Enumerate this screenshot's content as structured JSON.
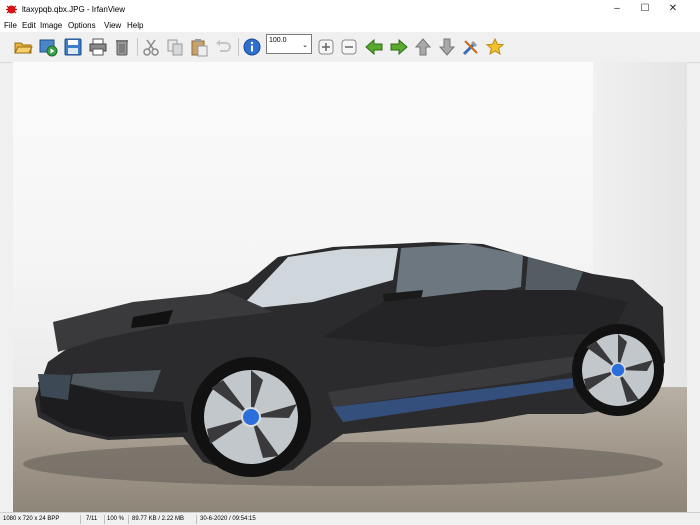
{
  "window": {
    "title": "ltaxypqb.qbx.JPG - IrfanView"
  },
  "menu": [
    "File",
    "Edit",
    "Image",
    "Options",
    "View",
    "Help"
  ],
  "toolbar": {
    "zoom_value": "100.0"
  },
  "icons": [
    "folder-open-icon",
    "slideshow-icon",
    "save-icon",
    "print-icon",
    "delete-icon",
    "cut-icon",
    "copy-icon",
    "paste-icon",
    "undo-icon",
    "info-icon",
    "zoom-in-icon",
    "zoom-out-icon",
    "previous-icon",
    "next-icon",
    "first-icon",
    "last-icon",
    "settings-icon",
    "favorite-icon"
  ],
  "status": {
    "dimensions": "1080 x 720 x 24 BPP",
    "index": "7/11",
    "zoom": "100 %",
    "filesize": "89.77 KB / 2.22 MB",
    "datetime": "30-6-2020 / 09:54:15"
  },
  "colors": {
    "toolbar_bg": "#f0f0f0",
    "car_body": "#2b2b2d",
    "car_accent_blue": "#2a6fdb"
  }
}
